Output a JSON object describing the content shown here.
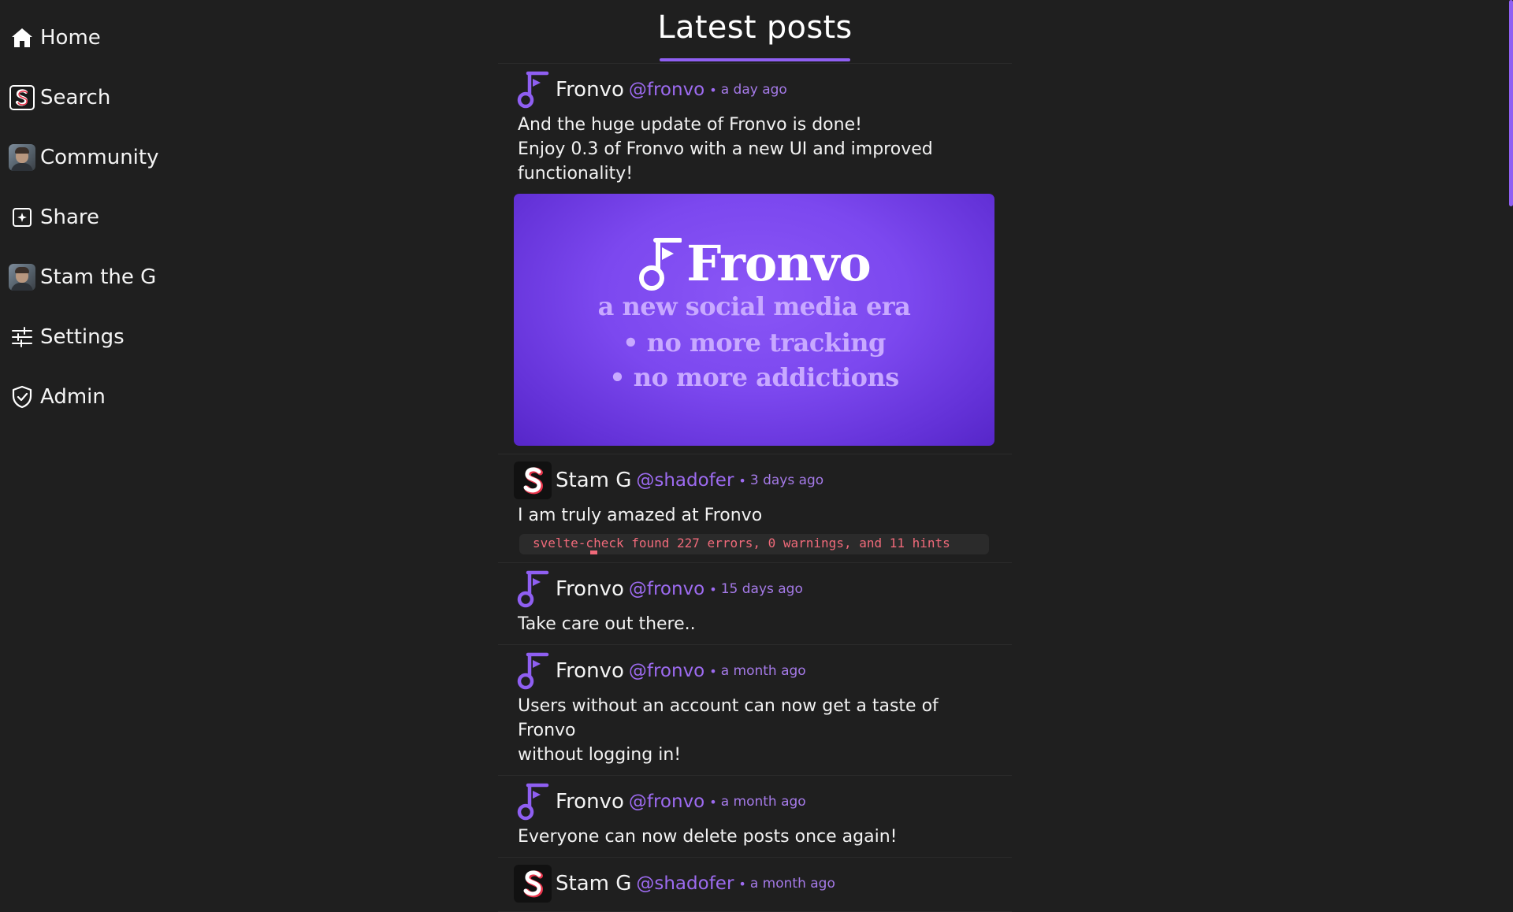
{
  "nav": {
    "items": [
      {
        "label": "Home",
        "icon": "home-icon"
      },
      {
        "label": "Search",
        "icon": "search-logo-icon"
      },
      {
        "label": "Community",
        "icon": "community-avatar"
      },
      {
        "label": "Share",
        "icon": "share-icon"
      },
      {
        "label": "Stam the G",
        "icon": "profile-avatar"
      },
      {
        "label": "Settings",
        "icon": "settings-sliders-icon"
      },
      {
        "label": "Admin",
        "icon": "shield-icon"
      }
    ]
  },
  "feed": {
    "title": "Latest posts",
    "posts": [
      {
        "author": "Fronvo",
        "handle": "@fronvo",
        "time": "a day ago",
        "lines": [
          "And the huge update of Fronvo is done!",
          "Enjoy 0.3 of Fronvo with a new UI and improved",
          "functionality!"
        ],
        "image": {
          "brand": "Fronvo",
          "line1": "a new social media era",
          "line2": "• no more tracking",
          "line3": "• no more addictions"
        }
      },
      {
        "author": "Stam G",
        "handle": "@shadofer",
        "time": "3 days ago",
        "lines": [
          "I am truly amazed at Fronvo"
        ],
        "code": "svelte-check found 227 errors, 0 warnings, and 11 hints"
      },
      {
        "author": "Fronvo",
        "handle": "@fronvo",
        "time": "15 days ago",
        "lines": [
          "Take care out there.."
        ]
      },
      {
        "author": "Fronvo",
        "handle": "@fronvo",
        "time": "a month ago",
        "lines": [
          "Users without an account can now get a taste of Fronvo",
          "without logging in!"
        ]
      },
      {
        "author": "Fronvo",
        "handle": "@fronvo",
        "time": "a month ago",
        "lines": [
          "Everyone can now delete posts once again!"
        ]
      },
      {
        "author": "Stam G",
        "handle": "@shadofer",
        "time": "a month ago",
        "lines": []
      }
    ]
  },
  "colors": {
    "background": "#1f1f1f",
    "accent": "#8f5ff2",
    "handle": "#9d6bf0"
  }
}
